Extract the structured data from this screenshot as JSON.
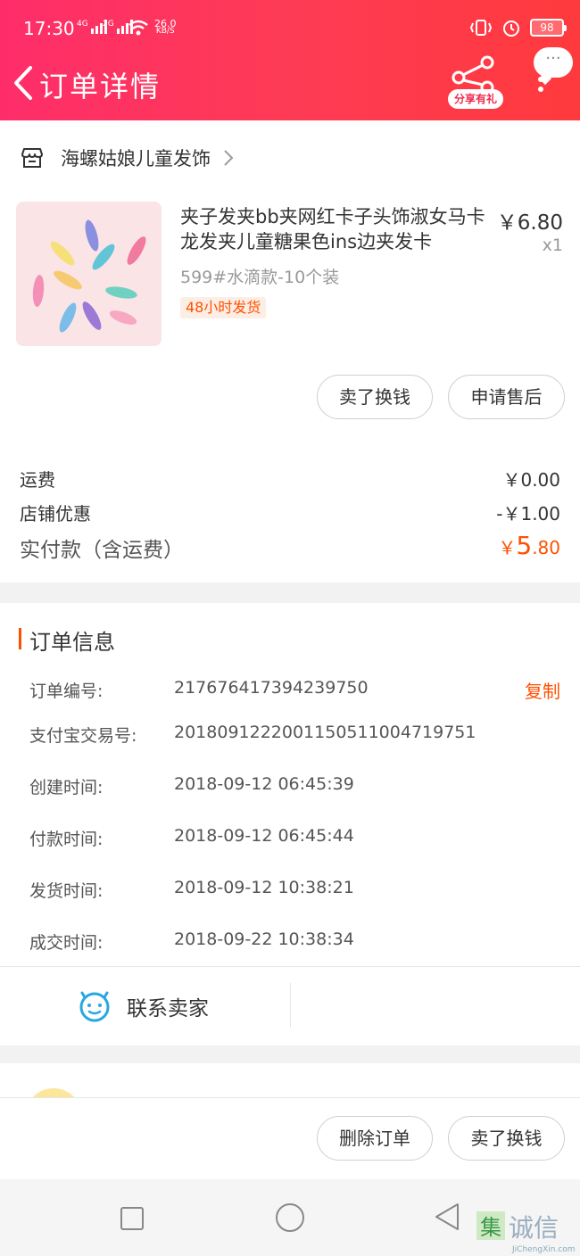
{
  "status_bar": {
    "time": "17:30",
    "network1": "4G",
    "network2": "2G",
    "speed_value": "26.0",
    "speed_unit": "KB/S",
    "battery": "98"
  },
  "nav": {
    "title": "订单详情",
    "share_label": "分享有礼",
    "more_bubble": "···"
  },
  "shop": {
    "name": "海螺姑娘儿童发饰"
  },
  "product": {
    "title": "夹子发夹bb夹网红卡子头饰淑女马卡龙发夹儿童糖果色ins边夹发卡",
    "price": "￥6.80",
    "qty": "x1",
    "sku": "599#水滴款-10个装",
    "badge": "48小时发货",
    "actions": [
      "卖了换钱",
      "申请售后"
    ]
  },
  "fees": [
    {
      "label": "运费",
      "value": "￥0.00"
    },
    {
      "label": "店铺优惠",
      "value": "-￥1.00"
    }
  ],
  "total": {
    "label": "实付款（含运费）",
    "currency": "￥",
    "integer": "5",
    "decimal": ".80"
  },
  "order_info": {
    "title": "订单信息",
    "copy_label": "复制",
    "rows": [
      {
        "label": "订单编号:",
        "value": "217676417394239750"
      },
      {
        "label": "支付宝交易号:",
        "value": "2018091222001150511004719751"
      },
      {
        "label": "创建时间:",
        "value": "2018-09-12 06:45:39"
      },
      {
        "label": "付款时间:",
        "value": "2018-09-12 06:45:44"
      },
      {
        "label": "发货时间:",
        "value": "2018-09-12 10:38:21"
      },
      {
        "label": "成交时间:",
        "value": "2018-09-22 10:38:34"
      }
    ]
  },
  "contact": {
    "label": "联系卖家"
  },
  "footer_actions": [
    "删除订单",
    "卖了换钱"
  ],
  "watermark": {
    "text": "JiChengXin.com"
  },
  "colors": {
    "accent": "#ff5000",
    "header_start": "#fe2d6a",
    "header_end": "#ff3a3d",
    "contact_icon": "#29a7e1"
  }
}
